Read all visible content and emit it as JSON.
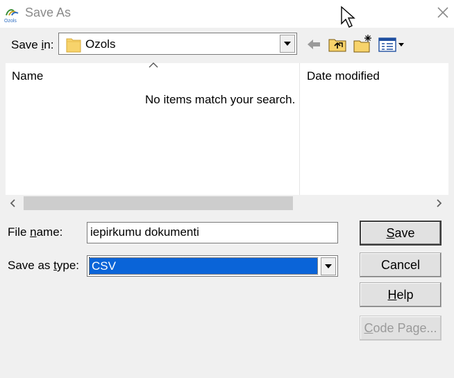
{
  "window": {
    "title": "Save As",
    "app_icon_text": "Ozols"
  },
  "save_in": {
    "label_pre": "Save ",
    "label_accel": "i",
    "label_post": "n:",
    "value": "Ozols"
  },
  "file_list": {
    "columns": [
      "Name",
      "Date modified"
    ],
    "empty_message": "No items match your search."
  },
  "file_name": {
    "label_pre": "File ",
    "label_accel": "n",
    "label_post": "ame:",
    "value": "iepirkumu dokumenti"
  },
  "save_as_type": {
    "label_pre": "Save as ",
    "label_accel": "t",
    "label_post": "ype:",
    "value": "CSV"
  },
  "buttons": {
    "save": {
      "accel": "S",
      "rest": "ave"
    },
    "cancel": {
      "label": "Cancel"
    },
    "help": {
      "accel": "H",
      "rest": "elp"
    },
    "code_page": {
      "accel": "C",
      "rest": "ode Page..."
    }
  },
  "colors": {
    "selection": "#0a64d8",
    "folder": "#f7d36b"
  },
  "icons": [
    "back-arrow-icon",
    "up-folder-icon",
    "new-folder-icon",
    "view-menu-icon",
    "folder-icon",
    "close-icon"
  ]
}
